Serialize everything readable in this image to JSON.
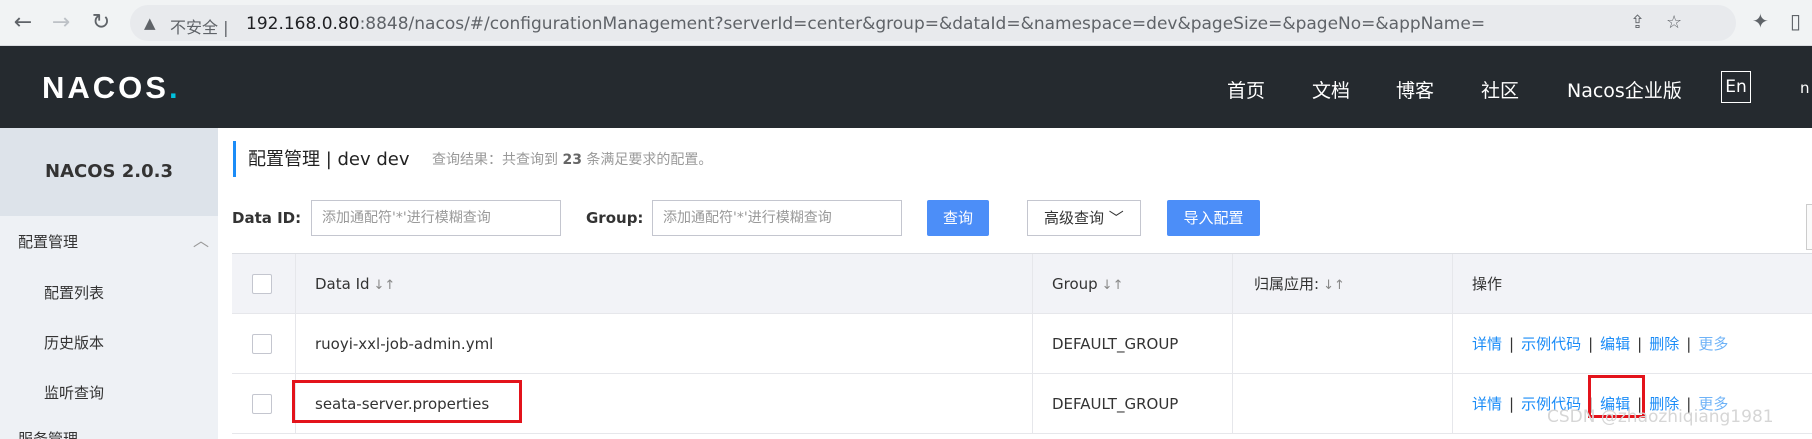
{
  "browser": {
    "insecure_label": "不安全",
    "url_host": "192.168.0.80",
    "url_rest": ":8848/nacos/#/configurationManagement?serverId=center&group=&dataId=&namespace=dev&pageSize=&pageNo=&appName="
  },
  "header": {
    "logo": "NACOS",
    "logo_dot": ".",
    "nav": [
      "首页",
      "文档",
      "博客",
      "社区",
      "Nacos企业版"
    ],
    "lang": "En",
    "cut_text": "n"
  },
  "sidebar": {
    "version": "NACOS 2.0.3",
    "group1": "配置管理",
    "items": [
      "配置列表",
      "历史版本",
      "监听查询"
    ],
    "group2": "服务管理"
  },
  "main": {
    "title": "配置管理 | dev dev",
    "result_prefix": "查询结果：共查询到",
    "result_count": "23",
    "result_suffix": "条满足要求的配置。",
    "dataid_label": "Data ID:",
    "dataid_placeholder": "添加通配符'*'进行模糊查询",
    "group_label": "Group:",
    "group_placeholder": "添加通配符'*'进行模糊查询",
    "query_btn": "查询",
    "advanced_btn": "高级查询",
    "import_btn": "导入配置"
  },
  "table": {
    "columns": [
      "Data Id",
      "Group",
      "归属应用:",
      "操作"
    ],
    "rows": [
      {
        "data_id": "ruoyi-xxl-job-admin.yml",
        "group": "DEFAULT_GROUP",
        "app": ""
      },
      {
        "data_id": "seata-server.properties",
        "group": "DEFAULT_GROUP",
        "app": ""
      }
    ],
    "ops": [
      "详情",
      "示例代码",
      "编辑",
      "删除",
      "更多"
    ]
  },
  "watermark": "CSDN @zhaozhiqiang1981",
  "colors": {
    "accent": "#1b8cf7",
    "header_bg": "#252a2f",
    "highlight": "#e3131b"
  }
}
